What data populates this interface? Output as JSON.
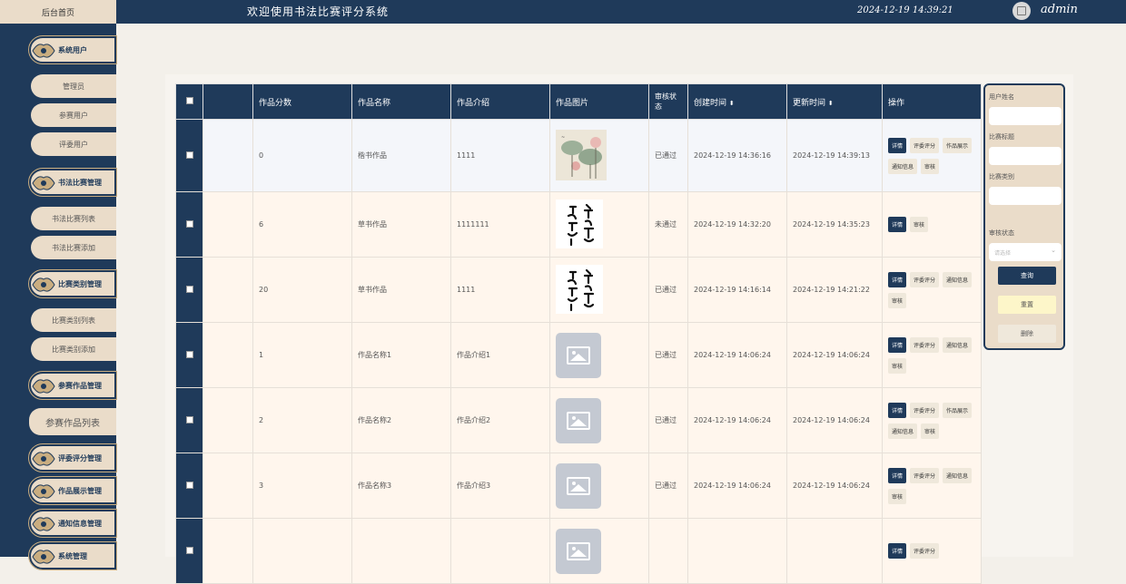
{
  "header": {
    "home_tab": "后台首页",
    "title": "欢迎使用书法比赛评分系统",
    "datetime": "2024-12-19 14:39:21",
    "user": "admin"
  },
  "sidebar": {
    "groups": [
      {
        "label": "系统用户",
        "items": [
          "管理员",
          "参赛用户",
          "评委用户"
        ]
      },
      {
        "label": "书法比赛管理",
        "items": [
          "书法比赛列表",
          "书法比赛添加"
        ]
      },
      {
        "label": "比赛类别管理",
        "items": [
          "比赛类别列表",
          "比赛类别添加"
        ]
      },
      {
        "label": "参赛作品管理",
        "items": [
          "参赛作品列表"
        ]
      },
      {
        "label": "评委评分管理",
        "items": []
      },
      {
        "label": "作品展示管理",
        "items": []
      },
      {
        "label": "通知信息管理",
        "items": []
      },
      {
        "label": "系统管理",
        "items": []
      }
    ]
  },
  "table": {
    "headers": [
      "作品分数",
      "作品名称",
      "作品介绍",
      "作品图片",
      "审核状态",
      "创建时间",
      "更新时间",
      "操作"
    ],
    "sort_mark": "⬍",
    "rows": [
      {
        "score": "0",
        "name": "楷书作品",
        "intro": "1111",
        "image": "lotus-painting",
        "status": "已通过",
        "created": "2024-12-19 14:36:16",
        "updated": "2024-12-19 14:39:13",
        "ops": [
          "详情",
          "评委评分",
          "作品展示",
          "通知信息",
          "审核"
        ]
      },
      {
        "score": "6",
        "name": "草书作品",
        "intro": "1111111",
        "image": "calligraphy",
        "status": "未通过",
        "created": "2024-12-19 14:32:20",
        "updated": "2024-12-19 14:35:23",
        "ops": [
          "详情",
          "审核"
        ]
      },
      {
        "score": "20",
        "name": "草书作品",
        "intro": "1111",
        "image": "calligraphy",
        "status": "已通过",
        "created": "2024-12-19 14:16:14",
        "updated": "2024-12-19 14:21:22",
        "ops": [
          "详情",
          "评委评分",
          "通知信息",
          "审核"
        ]
      },
      {
        "score": "1",
        "name": "作品名称1",
        "intro": "作品介绍1",
        "image": "placeholder",
        "status": "已通过",
        "created": "2024-12-19 14:06:24",
        "updated": "2024-12-19 14:06:24",
        "ops": [
          "详情",
          "评委评分",
          "通知信息",
          "审核"
        ]
      },
      {
        "score": "2",
        "name": "作品名称2",
        "intro": "作品介绍2",
        "image": "placeholder",
        "status": "已通过",
        "created": "2024-12-19 14:06:24",
        "updated": "2024-12-19 14:06:24",
        "ops": [
          "详情",
          "评委评分",
          "作品展示",
          "通知信息",
          "审核"
        ]
      },
      {
        "score": "3",
        "name": "作品名称3",
        "intro": "作品介绍3",
        "image": "placeholder",
        "status": "已通过",
        "created": "2024-12-19 14:06:24",
        "updated": "2024-12-19 14:06:24",
        "ops": [
          "详情",
          "评委评分",
          "通知信息",
          "审核"
        ]
      },
      {
        "score": "",
        "name": "",
        "intro": "",
        "image": "placeholder",
        "status": "",
        "created": "",
        "updated": "",
        "ops": [
          "详情",
          "评委评分"
        ]
      }
    ]
  },
  "filter": {
    "user_name_label": "用户姓名",
    "contest_title_label": "比赛标题",
    "contest_category_label": "比赛类别",
    "review_status_label": "审核状态",
    "review_status_placeholder": "请选择",
    "search_button": "查询",
    "reset_button": "重置",
    "delete_button": "删除"
  },
  "colors": {
    "navy": "#1f3a5a",
    "beige": "#eadcc9",
    "yellow": "#fdf6c9"
  }
}
